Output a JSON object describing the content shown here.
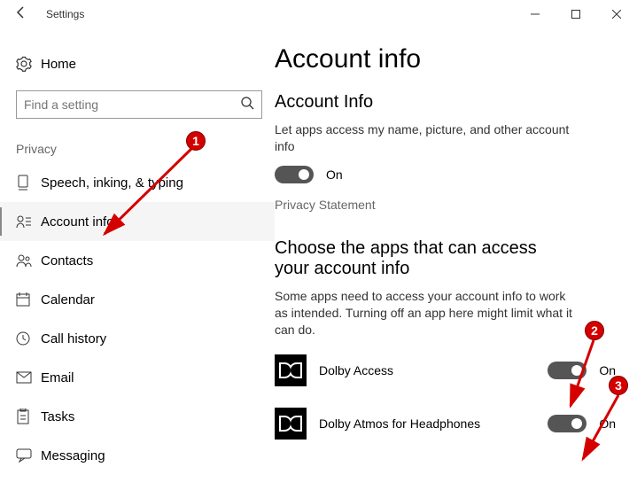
{
  "window": {
    "title": "Settings"
  },
  "sidebar": {
    "home_label": "Home",
    "search_placeholder": "Find a setting",
    "group_label": "Privacy",
    "items": [
      {
        "label": "Speech, inking, & typing"
      },
      {
        "label": "Account info"
      },
      {
        "label": "Contacts"
      },
      {
        "label": "Calendar"
      },
      {
        "label": "Call history"
      },
      {
        "label": "Email"
      },
      {
        "label": "Tasks"
      },
      {
        "label": "Messaging"
      }
    ]
  },
  "content": {
    "page_title": "Account info",
    "section1": {
      "heading": "Account Info",
      "description": "Let apps access my name, picture, and other account info",
      "toggle_state": "On",
      "privacy_link": "Privacy Statement"
    },
    "section2": {
      "heading": "Choose the apps that can access your account info",
      "description": "Some apps need to access your account info to work as intended. Turning off an app here might limit what it can do.",
      "apps": [
        {
          "name": "Dolby Access",
          "toggle_state": "On"
        },
        {
          "name": "Dolby Atmos for Headphones",
          "toggle_state": "On"
        }
      ]
    }
  },
  "annotations": {
    "badge1": "1",
    "badge2": "2",
    "badge3": "3"
  }
}
